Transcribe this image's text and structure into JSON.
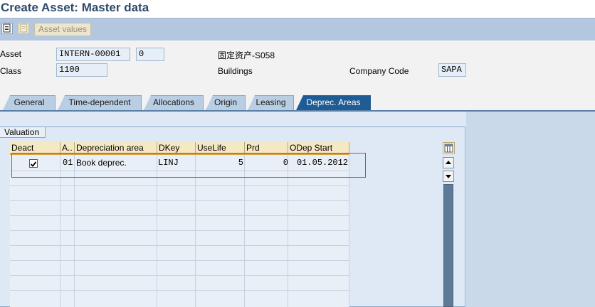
{
  "window": {
    "title": "Create Asset:  Master data"
  },
  "toolbar": {
    "asset_values_label": "Asset values"
  },
  "header": {
    "asset_label": "Asset",
    "asset_number": "INTERN-00001",
    "asset_subnumber": "0",
    "asset_description": "固定资产-S058",
    "class_label": "Class",
    "class_value": "1100",
    "class_description": "Buildings",
    "company_code_label": "Company Code",
    "company_code_value": "SAPA"
  },
  "tabs": [
    {
      "label": "General",
      "active": false
    },
    {
      "label": "Time-dependent",
      "active": false
    },
    {
      "label": "Allocations",
      "active": false
    },
    {
      "label": "Origin",
      "active": false
    },
    {
      "label": "Leasing",
      "active": false
    },
    {
      "label": "Deprec. Areas",
      "active": true
    }
  ],
  "valuation": {
    "group_title": "Valuation",
    "columns": [
      "Deact",
      "A..",
      "Depreciation area",
      "DKey",
      "UseLife",
      "Prd",
      "ODep Start"
    ],
    "rows": [
      {
        "deact": true,
        "area": "01",
        "depreciation_area": "Book deprec.",
        "dkey": "LINJ",
        "uselife": "5",
        "prd": "0",
        "odep_start": "01.05.2012"
      }
    ]
  },
  "colors": {
    "active_tab": "#1f5c94",
    "toolbar": "#b3c8e0",
    "header_cell": "#f5e9c4",
    "highlight": "#d23a3a"
  }
}
